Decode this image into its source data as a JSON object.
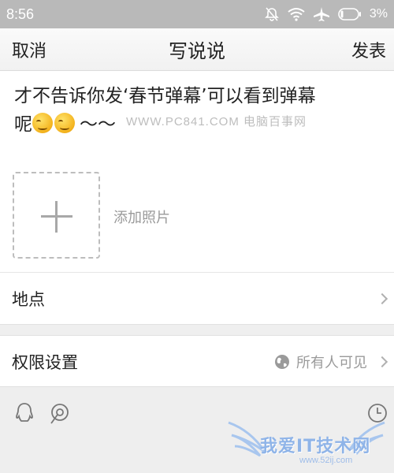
{
  "status_bar": {
    "time": "8:56",
    "battery": "3%"
  },
  "header": {
    "cancel": "取消",
    "title": "写说说",
    "publish": "发表"
  },
  "post": {
    "line1": "才不告诉你发‘春节弹幕’可以看到弹幕",
    "line2_prefix": "呢",
    "line2_suffix": "～～"
  },
  "watermark": "WWW.PC841.COM 电脑百事网",
  "add_photo": {
    "label": "添加照片"
  },
  "location": {
    "label": "地点"
  },
  "permissions": {
    "label": "权限设置",
    "value": "所有人可见"
  },
  "logo": {
    "text": "我爱IT技术网",
    "url": "www.52ij.com"
  }
}
